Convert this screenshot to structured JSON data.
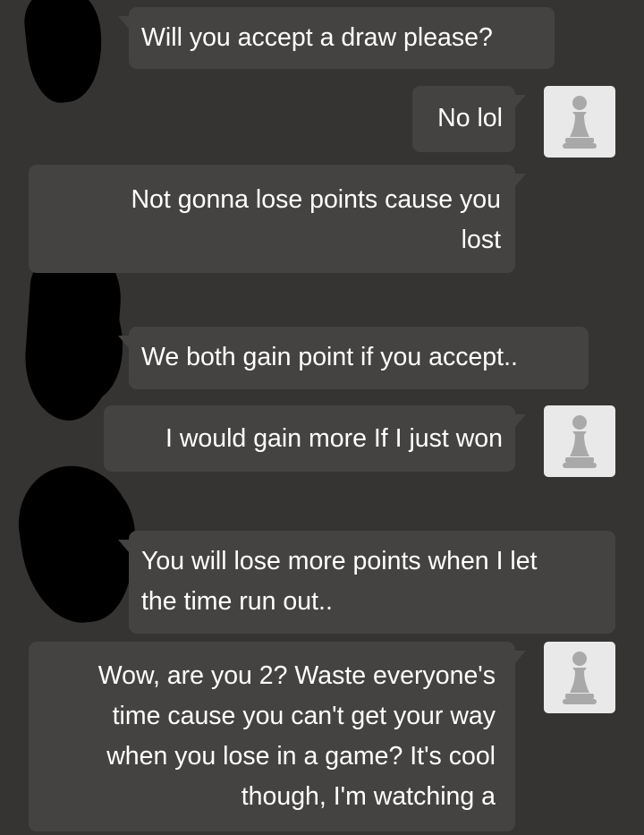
{
  "messages": [
    {
      "side": "in",
      "text": "Will you accept a draw please?"
    },
    {
      "side": "out",
      "text": "No lol"
    },
    {
      "side": "out",
      "lines": [
        "Not gonna lose points cause you",
        "lost"
      ]
    },
    {
      "side": "in",
      "text": "We both gain point if you accept.."
    },
    {
      "side": "out",
      "text": "I would gain more If I just won"
    },
    {
      "side": "in",
      "lines": [
        "You will lose more points when I let",
        "the time run out.."
      ]
    },
    {
      "side": "out",
      "lines": [
        "Wow, are you 2? Waste everyone's",
        "time cause you can't get your way",
        "when you lose in a game? It's cool",
        "though, I'm watching a"
      ]
    }
  ],
  "avatars": {
    "self_icon": "chess-pawn-icon",
    "icon_color": "#a9a9a9",
    "background": "#e9e9e9"
  },
  "colors": {
    "background": "#363432",
    "bubble": "#454341",
    "text": "#ffffff",
    "redaction": "#000000"
  }
}
